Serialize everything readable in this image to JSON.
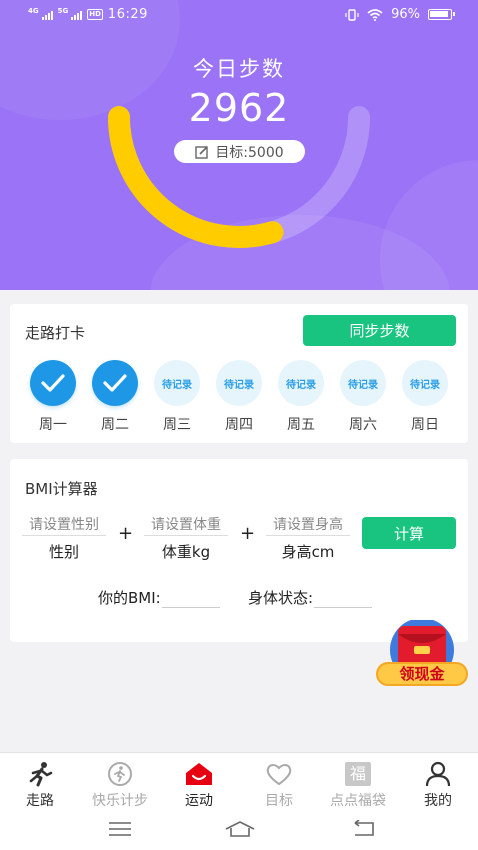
{
  "status_bar": {
    "net1": "4G",
    "net2": "5G",
    "hd": "HD",
    "time": "16:29",
    "battery": "96%"
  },
  "hero": {
    "title": "今日步数",
    "steps": "2962",
    "goal_label": "目标:5000",
    "progress_fraction": 0.59
  },
  "checkin": {
    "title": "走路打卡",
    "sync_label": "同步步数",
    "pending_text": "待记录",
    "days": [
      {
        "label": "周一",
        "done": true
      },
      {
        "label": "周二",
        "done": true
      },
      {
        "label": "周三",
        "done": false
      },
      {
        "label": "周四",
        "done": false
      },
      {
        "label": "周五",
        "done": false
      },
      {
        "label": "周六",
        "done": false
      },
      {
        "label": "周日",
        "done": false
      }
    ]
  },
  "bmi": {
    "title": "BMI计算器",
    "gender_placeholder": "请设置性别",
    "gender_value": "性别",
    "weight_placeholder": "请设置体重",
    "weight_value": "体重kg",
    "height_placeholder": "请设置身高",
    "height_value": "身高cm",
    "plus": "+",
    "calc_label": "计算",
    "bmi_label": "你的BMI:",
    "state_label": "身体状态:"
  },
  "float_badge": {
    "label": "领现金"
  },
  "tabs": [
    {
      "label": "走路",
      "icon": "runner-icon",
      "color": "#333333"
    },
    {
      "label": "快乐计步",
      "icon": "walk-circle-icon",
      "color": "#aaaaaa"
    },
    {
      "label": "运动",
      "icon": "home-smile-icon",
      "color": "#222222",
      "active": true
    },
    {
      "label": "目标",
      "icon": "heart-icon",
      "color": "#aaaaaa"
    },
    {
      "label": "点点福袋",
      "icon": "fu-bag-icon",
      "color": "#aaaaaa",
      "glyph": "福"
    },
    {
      "label": "我的",
      "icon": "person-icon",
      "color": "#333333"
    }
  ],
  "colors": {
    "hero": "#9a73f6",
    "accent_green": "#19c481",
    "check_blue": "#1e98e6",
    "gauge_yellow": "#ffcc00",
    "active_tab": "#e60012"
  }
}
